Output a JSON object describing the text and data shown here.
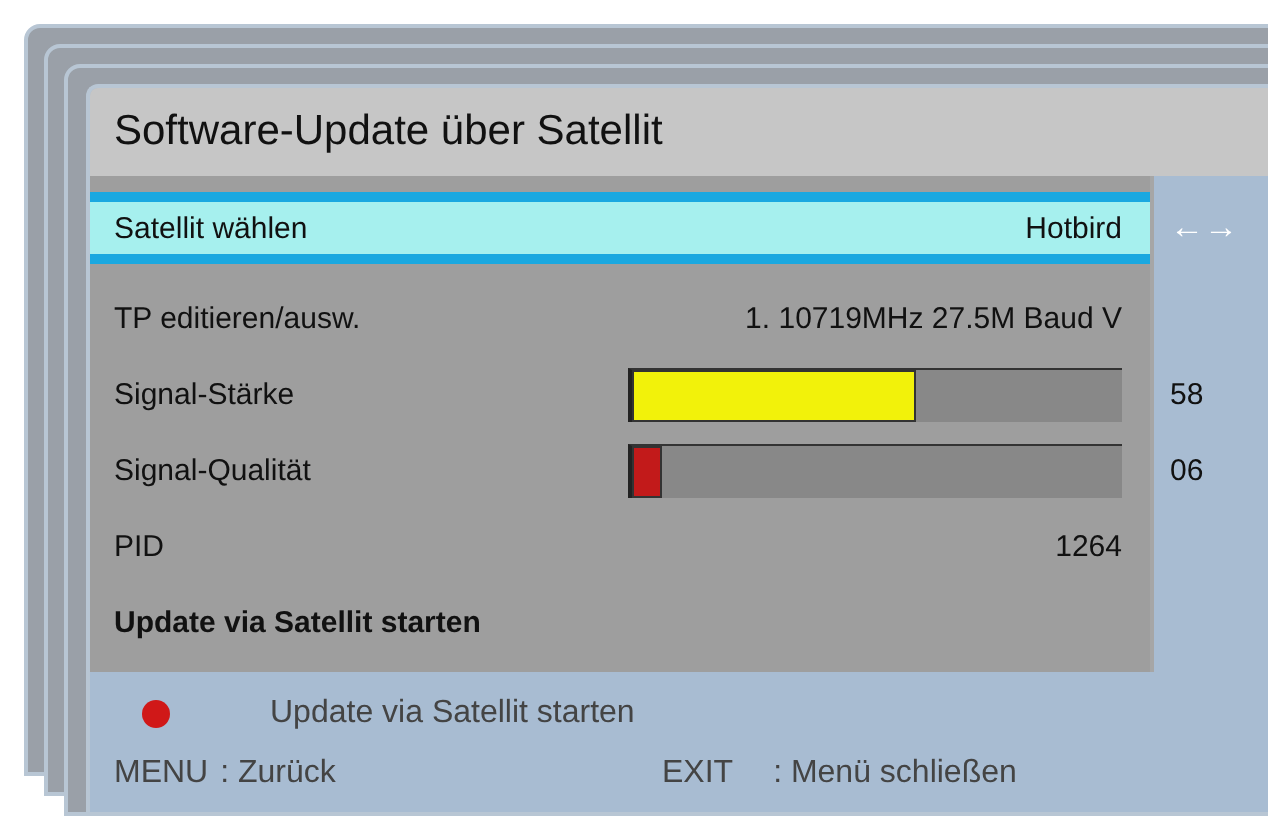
{
  "window": {
    "title": "Software-Update über Satellit"
  },
  "rows": [
    {
      "kind": "option",
      "label": "Satellit wählen",
      "value": "Hotbird",
      "selected": true,
      "hint": "←→"
    },
    {
      "kind": "text",
      "label": "TP editieren/ausw.",
      "value": "1. 10719MHz 27.5M Baud V",
      "selected": false
    },
    {
      "kind": "meter",
      "label": "Signal-Stärke",
      "level": 0.58,
      "reading": "58",
      "color": "#f2f20a"
    },
    {
      "kind": "meter",
      "label": "Signal-Qualität",
      "level": 0.06,
      "reading": "06",
      "color": "#c21a1a"
    },
    {
      "kind": "text",
      "label": "PID",
      "value": "1264",
      "selected": false
    },
    {
      "kind": "action",
      "label": "Update via Satellit starten",
      "selected": false
    }
  ],
  "footer": {
    "red_key": "Update via Satellit starten",
    "keys": [
      {
        "key": "MENU",
        "action": ": Zurück"
      },
      {
        "key": "EXIT",
        "action": ": Menü schließen"
      }
    ]
  }
}
